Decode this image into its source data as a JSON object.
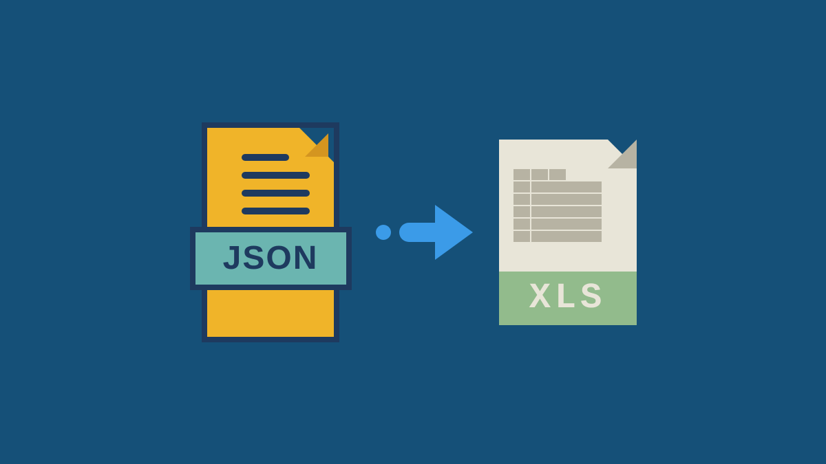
{
  "json_file": {
    "label": "JSON"
  },
  "xls_file": {
    "label": "XLS"
  }
}
